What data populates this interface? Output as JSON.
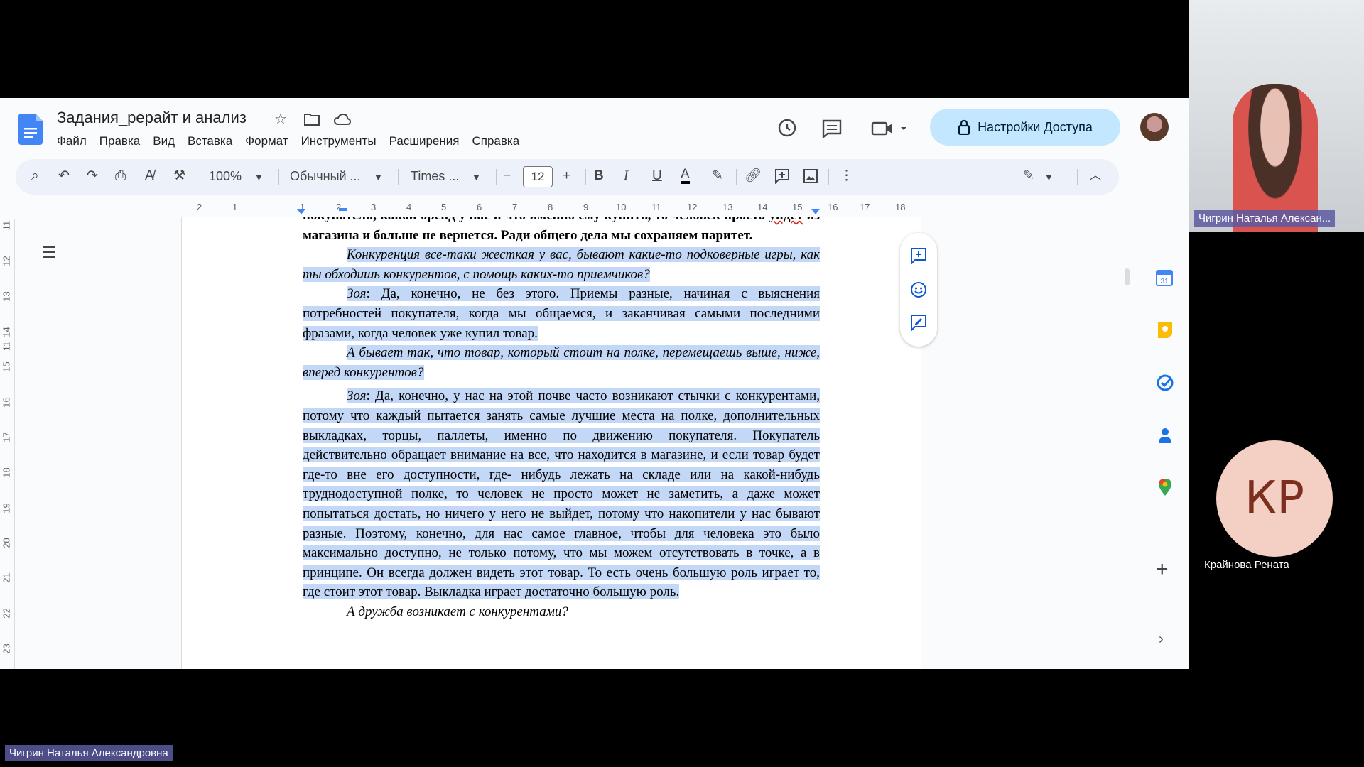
{
  "doc": {
    "title": "Задания_рерайт и анализ",
    "menu": [
      "Файл",
      "Правка",
      "Вид",
      "Вставка",
      "Формат",
      "Инструменты",
      "Расширения",
      "Справка"
    ],
    "share_label": "Настройки Доступа"
  },
  "toolbar": {
    "zoom": "100%",
    "style": "Обычный ...",
    "font": "Times ...",
    "font_size": "12",
    "bold": "B",
    "italic": "I",
    "underline": "U",
    "text_color": "A"
  },
  "ruler": {
    "h_numbers": [
      "2",
      "1",
      "1",
      "2",
      "3",
      "4",
      "5",
      "6",
      "7",
      "8",
      "9",
      "10",
      "11",
      "12",
      "13",
      "14",
      "15",
      "16",
      "17",
      "18"
    ],
    "v_numbers": [
      "11",
      "12",
      "13",
      "14",
      "15",
      "16",
      "17",
      "18",
      "19",
      "20",
      "21",
      "22",
      "23"
    ]
  },
  "text": {
    "p0_line": "покупателя, какой бренд у нас и что именно ему купить, то человек просто",
    "p0_word": "уйдёт",
    "p0_rest": " из магазина и больше не вернется. Ради общего дела мы сохраняем паритет.",
    "q1": "Конкуренция все-таки жесткая у вас, бывают какие-то подковерные игры, как ты обходишь конкурентов, с помощь каких-то приемчиков?",
    "a1_name": "Зоя",
    "a1": ": Да, конечно, не без этого. Приемы разные, начиная с выяснения потребностей покупателя, когда мы общаемся, и заканчивая самыми последними фразами, когда человек уже купил товар.",
    "q2": "А бывает так, что товар, который стоит на полке, перемещаешь выше, ниже, вперед конкурентов?",
    "a2_name": "Зоя",
    "a2": ": Да, конечно, у нас на этой почве часто возникают стычки с конкурентами, потому что каждый пытается занять самые лучшие места на полке, дополнительных выкладках, торцы, паллеты, именно по движению покупателя. Покупатель действительно обращает внимание на все, что находится в магазине, и если товар будет где-то вне его доступности, где- нибудь лежать на складе или на какой-нибудь труднодоступной полке, то человек не просто может не заметить, а даже может попытаться достать, но ничего у него не выйдет, потому что накопители у нас бывают разные. Поэтому, конечно, для нас самое главное, чтобы для человека это было максимально доступно, не только потому, что мы можем отсутствовать в точке, а в принципе. Он всегда должен видеть этот товар. То есть очень большую роль играет то, где стоит этот товар. Выкладка играет достаточно большую роль.",
    "q3": "А дружба возникает с конкурентами?"
  },
  "participants": {
    "presenter_name": "Чигрин Наталья Алексан...",
    "presenter_full": "Чигрин Наталья Александровна",
    "other_initials": "КР",
    "other_name": "Крайнова Рената"
  },
  "colors": {
    "accent": "#0b57d0",
    "selection": "#c3d7f6",
    "share_bg": "#c2e7ff"
  },
  "icons": [
    "docs-logo",
    "star-icon",
    "move-folder-icon",
    "cloud-icon",
    "history-icon",
    "comments-icon",
    "meet-icon",
    "lock-icon",
    "search-icon",
    "undo-icon",
    "redo-icon",
    "print-icon",
    "spellcheck-icon",
    "paint-format-icon",
    "link-icon",
    "add-comment-icon",
    "image-icon",
    "more-icon",
    "edit-mode-icon",
    "collapse-icon",
    "outline-icon",
    "emoji-icon",
    "suggest-edit-icon",
    "calendar-icon",
    "keep-icon",
    "tasks-icon",
    "contacts-icon",
    "maps-icon",
    "plus-icon",
    "chevron-right-icon"
  ]
}
